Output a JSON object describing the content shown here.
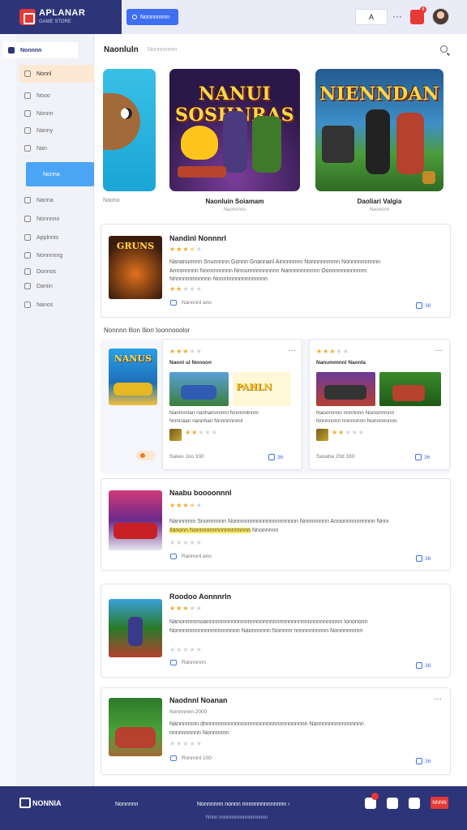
{
  "header": {
    "brand": "APLANAR",
    "brand_sub": "GAME STORE",
    "primary_button": "Nonnnnnnn",
    "input_value": "A",
    "more": "···",
    "notifications": "8"
  },
  "sidebar": {
    "items": [
      {
        "label": "Nonnnn",
        "icon": "home-icon"
      },
      {
        "label": "Nonnl",
        "icon": "star-icon"
      },
      {
        "label": "Nooo",
        "icon": "apps-icon"
      },
      {
        "label": "Nonnn",
        "icon": "grid-icon"
      },
      {
        "label": "Nanny",
        "icon": "list-icon"
      },
      {
        "label": "Nan",
        "icon": "doc-icon"
      },
      {
        "label": "Nonna",
        "icon": "folder-icon"
      },
      {
        "label": "Nanna",
        "icon": "heart-icon"
      },
      {
        "label": "Nonnnno",
        "icon": "clock-icon"
      },
      {
        "label": "Applnnts",
        "icon": "box-icon"
      },
      {
        "label": "Nonnnnng",
        "icon": "tag-icon"
      },
      {
        "label": "Donnos",
        "icon": "chart-icon"
      },
      {
        "label": "Daniin",
        "icon": "user-icon"
      },
      {
        "label": "Nanos",
        "icon": "settings-icon"
      }
    ]
  },
  "main": {
    "section_title": "Naonluln",
    "section_sub": "Nonnnnnnn",
    "carousel": [
      {
        "title": "",
        "caption": "Naono",
        "sub": ""
      },
      {
        "title": "NANUI SOSHNRAS",
        "caption": "Naonluin Soiamam",
        "sub": "Naononns"
      },
      {
        "title": "NIENNDAN",
        "caption": "Daoliari Valgia",
        "sub": "Naononn"
      }
    ],
    "featured": {
      "thumb_title": "GRUNS",
      "title": "Nandinl Nonnnrl",
      "rating": 3.5,
      "desc": "Nananunnnn Snunnnnn Gonnn Gnannanl Ainnnnnnn Nonnnnnnnnn Nonnnnnnnnnn Annonnnnn Nonnnnnnnn Nnnunnnnnnnnnn Nannnnnnnnnn Ooonnnnnnnnnnn Nnnnnnnnnnnnn Nnnnnnnnnnnnnnnnn",
      "sub_rating": 2,
      "meta": "Nanonnl ano",
      "badge": "36"
    },
    "group_title": "Nonnnn Ilion Ilion Ioonnooolor",
    "group_cards": [
      {
        "thumb_title": "NANUS",
        "rating": 3,
        "title": "Naonl ul Nonoon",
        "img_title": "PAHLN",
        "lines": [
          "Nanmmlan nanhamnnmn Nnnnmlnnm",
          "Nnnnaan nannhan Nnnnnnnnnl"
        ],
        "mini_rating": 2,
        "meta": "Saiwu Joo 330",
        "badge": "36"
      },
      {
        "rating": 3,
        "title": "Nanummnnl Naonla",
        "lines": [
          "Naoomnnn nnnnnnn Nonomnnnn",
          "Nnnnnnnn nnnnnnnn Nonnnnnnnn"
        ],
        "mini_rating": 2,
        "meta": "Sasaha 20d 330",
        "badge": "36"
      }
    ],
    "cards": [
      {
        "title": "Naabu boooonnnl",
        "rating": 3.5,
        "desc": "Nannnnnn Snonnnnnn Nonnnnnnnnnnnnnnnnnnnn Nnnnnnnnn Annonnnnnnnnnn Nnnnnnnnnn",
        "highlight": "Ilanonn Nonnnnnnnnnnnnnnnnn",
        "desc_tail": "Nnonnnnn",
        "mini_rating": 0,
        "meta": "Rannonl ano",
        "badge": "36"
      },
      {
        "title": "Roodoo Aonnnrln",
        "rating": 3,
        "desc": "Nanonnnnmoannnnnnnnnnnnnnnnnnnnnnnnnnnnnnnnnnnnnnnnnnn Ionononn Nonnnnnnnnnnnnnnnnnnnn Naonnnnnn Nonnnn nnnnnnnnnnn Nonnnnnnnn",
        "mini_rating": 0,
        "meta": "Rannnnnn",
        "badge": "36"
      },
      {
        "title": "Naodnnl Noanan",
        "sub": "Nonnnnnn 2000",
        "desc": "Nannnnnnn dnnnnnnnnnnnnnnnnnnnnnnnnnnnnnnnnn Nannnnnnnnnnnnnnn nnnnnnnnnn Nonnnnnn",
        "mini_rating": 0,
        "meta": "Ronnnnl 100",
        "badge": "36"
      }
    ]
  },
  "footer": {
    "brand": "NONNIA",
    "link1": "Nonnnnn",
    "link2": "Nonnnnnn nonnn nnnnnnnnnnnnnn  ›",
    "sub": "Nnnn nnnnnnnnnnnnnnnnnn",
    "cta": "NNNN"
  },
  "colors": {
    "brand_navy": "#2d3578",
    "accent_blue": "#3e6ff0",
    "red": "#e53935",
    "star": "#f5a623",
    "sidebar_orange": "#fde8d4",
    "sidebar_blue": "#4aa6f5"
  }
}
